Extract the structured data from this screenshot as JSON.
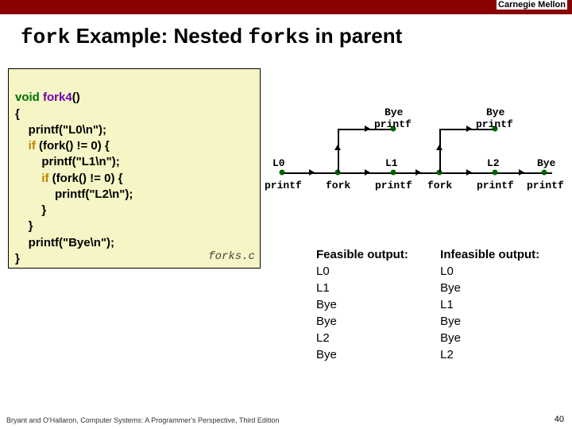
{
  "header": {
    "institution": "Carnegie Mellon"
  },
  "title": {
    "t1": "fork",
    "t2": " Example: Nested ",
    "t3": "fork",
    "t4": "s in parent"
  },
  "code": {
    "l1a": "void",
    "l1b": " fork4",
    "l1c": "()",
    "l2": "{",
    "l3": "    printf(\"L0\\n\");",
    "l4a": "    ",
    "l4b": "if",
    "l4c": " (fork() != 0) {",
    "l5": "        printf(\"L1\\n\");",
    "l6a": "        ",
    "l6b": "if",
    "l6c": " (fork() != 0) {",
    "l7": "            printf(\"L2\\n\");",
    "l8": "        }",
    "l9": "    }",
    "l10": "    printf(\"Bye\\n\");",
    "l11": "}",
    "file": "forks.c"
  },
  "diagram": {
    "L0": "L0",
    "L1": "L1",
    "L2": "L2",
    "Bye": "Bye",
    "printf": "printf",
    "fork": "fork"
  },
  "out": {
    "feas_hdr": "Feasible output:",
    "feas": [
      "L0",
      "L1",
      "Bye",
      "Bye",
      "L2",
      "Bye"
    ],
    "inf_hdr": "Infeasible output:",
    "inf": [
      "L0",
      "Bye",
      "L1",
      "Bye",
      "Bye",
      "L2"
    ]
  },
  "footer": {
    "credit": "Bryant and O'Hallaron, Computer Systems: A Programmer's Perspective, Third Edition",
    "page": "40"
  }
}
